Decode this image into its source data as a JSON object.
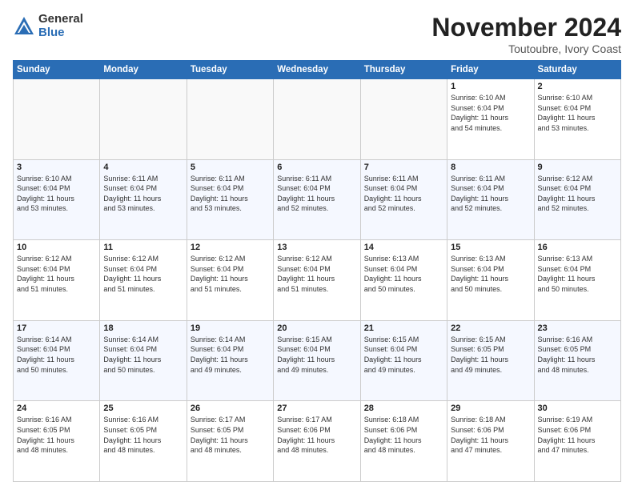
{
  "logo": {
    "general": "General",
    "blue": "Blue"
  },
  "title": "November 2024",
  "location": "Toutoubre, Ivory Coast",
  "days_of_week": [
    "Sunday",
    "Monday",
    "Tuesday",
    "Wednesday",
    "Thursday",
    "Friday",
    "Saturday"
  ],
  "weeks": [
    [
      {
        "day": "",
        "info": ""
      },
      {
        "day": "",
        "info": ""
      },
      {
        "day": "",
        "info": ""
      },
      {
        "day": "",
        "info": ""
      },
      {
        "day": "",
        "info": ""
      },
      {
        "day": "1",
        "info": "Sunrise: 6:10 AM\nSunset: 6:04 PM\nDaylight: 11 hours\nand 54 minutes."
      },
      {
        "day": "2",
        "info": "Sunrise: 6:10 AM\nSunset: 6:04 PM\nDaylight: 11 hours\nand 53 minutes."
      }
    ],
    [
      {
        "day": "3",
        "info": "Sunrise: 6:10 AM\nSunset: 6:04 PM\nDaylight: 11 hours\nand 53 minutes."
      },
      {
        "day": "4",
        "info": "Sunrise: 6:11 AM\nSunset: 6:04 PM\nDaylight: 11 hours\nand 53 minutes."
      },
      {
        "day": "5",
        "info": "Sunrise: 6:11 AM\nSunset: 6:04 PM\nDaylight: 11 hours\nand 53 minutes."
      },
      {
        "day": "6",
        "info": "Sunrise: 6:11 AM\nSunset: 6:04 PM\nDaylight: 11 hours\nand 52 minutes."
      },
      {
        "day": "7",
        "info": "Sunrise: 6:11 AM\nSunset: 6:04 PM\nDaylight: 11 hours\nand 52 minutes."
      },
      {
        "day": "8",
        "info": "Sunrise: 6:11 AM\nSunset: 6:04 PM\nDaylight: 11 hours\nand 52 minutes."
      },
      {
        "day": "9",
        "info": "Sunrise: 6:12 AM\nSunset: 6:04 PM\nDaylight: 11 hours\nand 52 minutes."
      }
    ],
    [
      {
        "day": "10",
        "info": "Sunrise: 6:12 AM\nSunset: 6:04 PM\nDaylight: 11 hours\nand 51 minutes."
      },
      {
        "day": "11",
        "info": "Sunrise: 6:12 AM\nSunset: 6:04 PM\nDaylight: 11 hours\nand 51 minutes."
      },
      {
        "day": "12",
        "info": "Sunrise: 6:12 AM\nSunset: 6:04 PM\nDaylight: 11 hours\nand 51 minutes."
      },
      {
        "day": "13",
        "info": "Sunrise: 6:12 AM\nSunset: 6:04 PM\nDaylight: 11 hours\nand 51 minutes."
      },
      {
        "day": "14",
        "info": "Sunrise: 6:13 AM\nSunset: 6:04 PM\nDaylight: 11 hours\nand 50 minutes."
      },
      {
        "day": "15",
        "info": "Sunrise: 6:13 AM\nSunset: 6:04 PM\nDaylight: 11 hours\nand 50 minutes."
      },
      {
        "day": "16",
        "info": "Sunrise: 6:13 AM\nSunset: 6:04 PM\nDaylight: 11 hours\nand 50 minutes."
      }
    ],
    [
      {
        "day": "17",
        "info": "Sunrise: 6:14 AM\nSunset: 6:04 PM\nDaylight: 11 hours\nand 50 minutes."
      },
      {
        "day": "18",
        "info": "Sunrise: 6:14 AM\nSunset: 6:04 PM\nDaylight: 11 hours\nand 50 minutes."
      },
      {
        "day": "19",
        "info": "Sunrise: 6:14 AM\nSunset: 6:04 PM\nDaylight: 11 hours\nand 49 minutes."
      },
      {
        "day": "20",
        "info": "Sunrise: 6:15 AM\nSunset: 6:04 PM\nDaylight: 11 hours\nand 49 minutes."
      },
      {
        "day": "21",
        "info": "Sunrise: 6:15 AM\nSunset: 6:04 PM\nDaylight: 11 hours\nand 49 minutes."
      },
      {
        "day": "22",
        "info": "Sunrise: 6:15 AM\nSunset: 6:05 PM\nDaylight: 11 hours\nand 49 minutes."
      },
      {
        "day": "23",
        "info": "Sunrise: 6:16 AM\nSunset: 6:05 PM\nDaylight: 11 hours\nand 48 minutes."
      }
    ],
    [
      {
        "day": "24",
        "info": "Sunrise: 6:16 AM\nSunset: 6:05 PM\nDaylight: 11 hours\nand 48 minutes."
      },
      {
        "day": "25",
        "info": "Sunrise: 6:16 AM\nSunset: 6:05 PM\nDaylight: 11 hours\nand 48 minutes."
      },
      {
        "day": "26",
        "info": "Sunrise: 6:17 AM\nSunset: 6:05 PM\nDaylight: 11 hours\nand 48 minutes."
      },
      {
        "day": "27",
        "info": "Sunrise: 6:17 AM\nSunset: 6:06 PM\nDaylight: 11 hours\nand 48 minutes."
      },
      {
        "day": "28",
        "info": "Sunrise: 6:18 AM\nSunset: 6:06 PM\nDaylight: 11 hours\nand 48 minutes."
      },
      {
        "day": "29",
        "info": "Sunrise: 6:18 AM\nSunset: 6:06 PM\nDaylight: 11 hours\nand 47 minutes."
      },
      {
        "day": "30",
        "info": "Sunrise: 6:19 AM\nSunset: 6:06 PM\nDaylight: 11 hours\nand 47 minutes."
      }
    ]
  ]
}
